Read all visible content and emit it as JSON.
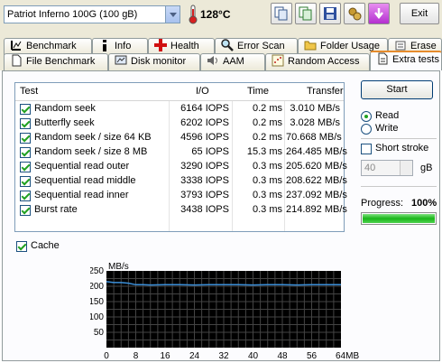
{
  "toolbar": {
    "drive": "Patriot Inferno 100G    (100 gB)",
    "temperature": "128°C",
    "exit_label": "Exit"
  },
  "tabs_row1": [
    "Benchmark",
    "Info",
    "Health",
    "Error Scan",
    "Folder Usage",
    "Erase"
  ],
  "tabs_row2": [
    "File Benchmark",
    "Disk monitor",
    "AAM",
    "Random Access",
    "Extra tests"
  ],
  "table": {
    "headers": [
      "Test",
      "I/O",
      "Time",
      "Transfer"
    ],
    "rows": [
      {
        "test": "Random seek",
        "io": "6164 IOPS",
        "time": "0.2 ms",
        "transfer": "3.010 MB/s"
      },
      {
        "test": "Butterfly seek",
        "io": "6202 IOPS",
        "time": "0.2 ms",
        "transfer": "3.028 MB/s"
      },
      {
        "test": "Random seek / size 64 KB",
        "io": "4596 IOPS",
        "time": "0.2 ms",
        "transfer": "70.668 MB/s"
      },
      {
        "test": "Random seek / size 8 MB",
        "io": "65 IOPS",
        "time": "15.3 ms",
        "transfer": "264.485 MB/s"
      },
      {
        "test": "Sequential read outer",
        "io": "3290 IOPS",
        "time": "0.3 ms",
        "transfer": "205.620 MB/s"
      },
      {
        "test": "Sequential read middle",
        "io": "3338 IOPS",
        "time": "0.3 ms",
        "transfer": "208.622 MB/s"
      },
      {
        "test": "Sequential read inner",
        "io": "3793 IOPS",
        "time": "0.3 ms",
        "transfer": "237.092 MB/s"
      },
      {
        "test": "Burst rate",
        "io": "3438 IOPS",
        "time": "0.3 ms",
        "transfer": "214.892 MB/s"
      }
    ]
  },
  "side": {
    "start_label": "Start",
    "read_label": "Read",
    "write_label": "Write",
    "short_stroke_label": "Short stroke",
    "stroke_value": "40",
    "stroke_unit": "gB",
    "progress_label": "Progress:",
    "progress_value": "100%",
    "progress_fraction": 1.0
  },
  "cache_label": "Cache",
  "chart_data": {
    "type": "line",
    "ylabel": "MB/s",
    "ylim": [
      0,
      250
    ],
    "yticks": [
      "250",
      "200",
      "150",
      "100",
      "50"
    ],
    "xlim": [
      0,
      64
    ],
    "xticks": [
      "0",
      "8",
      "16",
      "24",
      "32",
      "40",
      "48",
      "56",
      "64MB"
    ],
    "grid": true,
    "series": [
      {
        "x": [
          0,
          2,
          4,
          6,
          8,
          10,
          12,
          16,
          20,
          24,
          28,
          32,
          36,
          40,
          44,
          48,
          52,
          56,
          60,
          64
        ],
        "values": [
          215,
          212,
          212,
          210,
          205,
          205,
          204,
          205,
          205,
          204,
          205,
          205,
          205,
          204,
          205,
          205,
          204,
          205,
          205,
          205
        ]
      }
    ],
    "line_color": "#3b8fd9",
    "background": "#000000"
  }
}
